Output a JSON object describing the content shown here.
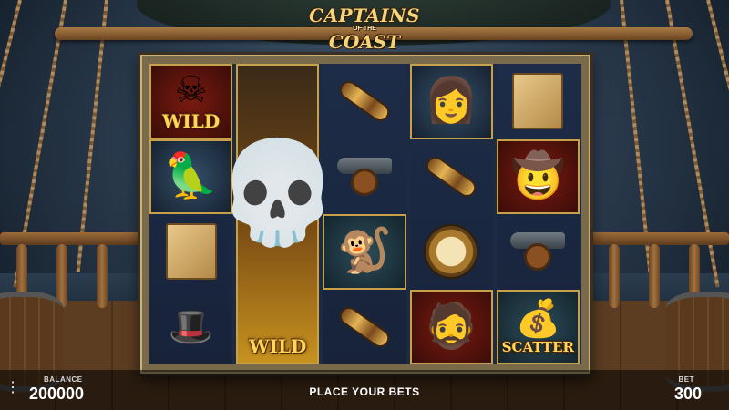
{
  "logo": {
    "line1": "CAPTAINS",
    "line2": "OF THE",
    "line3": "COAST"
  },
  "reels": [
    [
      {
        "icon": "skull-wild-icon",
        "glyph": "☠",
        "label": "WILD"
      },
      {
        "icon": "parrot-icon",
        "glyph": "🦜",
        "label": ""
      },
      {
        "icon": "treasure-map-icon",
        "glyph": "",
        "label": ""
      },
      {
        "icon": "pirate-hat-icon",
        "glyph": "🎩",
        "label": ""
      }
    ],
    [
      {
        "icon": "skeleton-captain-wild-icon",
        "glyph": "💀",
        "label": "WILD"
      }
    ],
    [
      {
        "icon": "spyglass-icon",
        "glyph": "",
        "label": ""
      },
      {
        "icon": "cannon-icon",
        "glyph": "",
        "label": ""
      },
      {
        "icon": "monkey-icon",
        "glyph": "🐒",
        "label": ""
      },
      {
        "icon": "spyglass-icon",
        "glyph": "",
        "label": ""
      }
    ],
    [
      {
        "icon": "pirate-woman-icon",
        "glyph": "👩",
        "label": ""
      },
      {
        "icon": "spyglass-icon",
        "glyph": "",
        "label": ""
      },
      {
        "icon": "compass-icon",
        "glyph": "",
        "label": ""
      },
      {
        "icon": "eyepatch-pirate-icon",
        "glyph": "🧔",
        "label": ""
      }
    ],
    [
      {
        "icon": "treasure-map-icon",
        "glyph": "",
        "label": ""
      },
      {
        "icon": "pirate-captain-icon",
        "glyph": "🤠",
        "label": ""
      },
      {
        "icon": "cannon-icon",
        "glyph": "",
        "label": ""
      },
      {
        "icon": "treasure-chest-scatter-icon",
        "glyph": "💰",
        "label": "SCATTER"
      }
    ]
  ],
  "bottom": {
    "menu_icon": "hamburger-menu-icon",
    "balance_label": "BALANCE",
    "balance_value": "200000",
    "status": "PLACE YOUR BETS",
    "bet_label": "BET",
    "bet_value": "300"
  },
  "colors": {
    "reel_background": "#1c2a44",
    "frame_gold": "#c7a04a",
    "wild_text": "#ffd65a"
  }
}
